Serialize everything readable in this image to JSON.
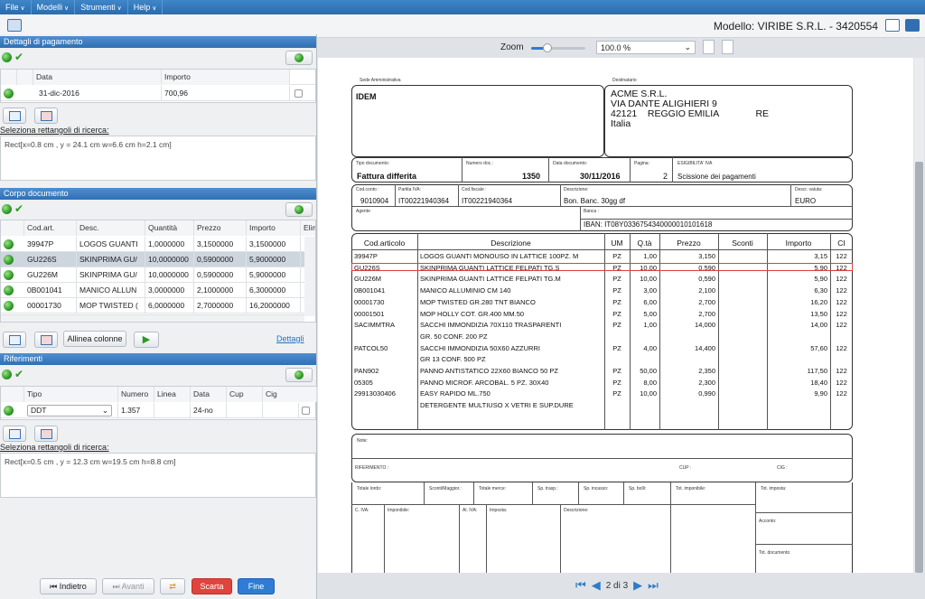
{
  "menu": [
    "File",
    "Modelli",
    "Strumenti",
    "Help"
  ],
  "model_title": "Modello: VIRIBE S.R.L. - 3420554",
  "zoom": {
    "label": "Zoom",
    "value": "100.0 %",
    "level": 0.3
  },
  "pagamento": {
    "title": "Dettagli di pagamento",
    "cols": [
      "Data",
      "Importo"
    ],
    "rows": [
      {
        "data": "31-dic-2016",
        "importo": "700,96"
      }
    ]
  },
  "ricerca1": {
    "label": "Seleziona rettangoli di ricerca:",
    "value": "Rect[x=0.8 cm , y = 24.1 cm w=6.6 cm h=2.1 cm]"
  },
  "corpo": {
    "title": "Corpo documento",
    "cols": [
      "Cod.art.",
      "Desc.",
      "Quantità",
      "Prezzo",
      "Importo",
      "Elim"
    ],
    "rows": [
      {
        "cod": "39947P",
        "desc": "LOGOS GUANTI",
        "qta": "1,0000000",
        "prezzo": "3,1500000",
        "importo": "3,1500000"
      },
      {
        "cod": "GU226S",
        "desc": "SKINPRIMA GU/",
        "qta": "10,0000000",
        "prezzo": "0,5900000",
        "importo": "5,9000000"
      },
      {
        "cod": "GU226M",
        "desc": "SKINPRIMA GU/",
        "qta": "10,0000000",
        "prezzo": "0,5900000",
        "importo": "5,9000000"
      },
      {
        "cod": "0B001041",
        "desc": "MANICO ALLUN",
        "qta": "3,0000000",
        "prezzo": "2,1000000",
        "importo": "6,3000000"
      },
      {
        "cod": "00001730",
        "desc": "MOP TWISTED (",
        "qta": "6,0000000",
        "prezzo": "2,7000000",
        "importo": "16,2000000"
      }
    ],
    "allinea": "Allinea colonne",
    "dettagli": "Dettagli"
  },
  "riferimenti": {
    "title": "Riferimenti",
    "cols": [
      "Tipo",
      "Numero",
      "Linea",
      "Data",
      "Cup",
      "Cig"
    ],
    "rows": [
      {
        "tipo": "DDT",
        "numero": "1.357",
        "linea": "",
        "data": "24-no",
        "cup": "",
        "cig": ""
      }
    ]
  },
  "ricerca2": {
    "label": "Seleziona rettangoli di ricerca:",
    "value": "Rect[x=0.5 cm , y = 12.3 cm w=19.5 cm h=8.8 cm]"
  },
  "footer": {
    "indietro": "Indietro",
    "avanti": "Avanti",
    "scarta": "Scarta",
    "fine": "Fine"
  },
  "doc": {
    "sede_label": "Sede Amministrativa",
    "sede": "IDEM",
    "dest_label": "Destinatario",
    "dest": [
      "ACME S.R.L.",
      "VIA DANTE ALIGHIERI 9",
      "42121    REGGIO EMILIA              RE",
      "Italia"
    ],
    "tipo_label": "Tipo documento:",
    "tipo": "Fattura differita",
    "num_label": "Numero doc.:",
    "num": "1350",
    "data_label": "Data documento:",
    "data": "30/11/2016",
    "pag_label": "Pagina:",
    "pag": "2",
    "esig_label": "ESIGIBILITA' IVA",
    "esig": "Scissione dei pagamenti",
    "conto_label": "Cod.conto :",
    "conto": "9010904",
    "piva_label": "Partita IVA:",
    "piva": "IT00221940364",
    "cf_label": "Cod.fiscale :",
    "cf": "IT00221940364",
    "descr_label": "Descrizione:",
    "descr": "Bon. Banc. 30gg df",
    "valuta_label": "Descr. valuta:",
    "valuta": "EURO",
    "agente_label": "Agente",
    "banca_label": "Banca :",
    "iban": "IBAN: IT08Y0336754340000010101618",
    "cols": [
      "Cod.articolo",
      "Descrizione",
      "UM",
      "Q.tà",
      "Prezzo",
      "Sconti",
      "Importo",
      "CI"
    ],
    "rows": [
      [
        "39947P",
        "LOGOS GUANTI MONOUSO IN LATTICE 100PZ. M",
        "PZ",
        "1,00",
        "3,150",
        "",
        "3,15",
        "122"
      ],
      [
        "GU226S",
        "SKINPRIMA GUANTI LATTICE FELPATI TG.S",
        "PZ",
        "10,00",
        "0,590",
        "",
        "5,90",
        "122"
      ],
      [
        "GU226M",
        "SKINPRIMA GUANTI LATTICE FELPATI TG.M",
        "PZ",
        "10,00",
        "0,590",
        "",
        "5,90",
        "122"
      ],
      [
        "0B001041",
        "MANICO ALLUMINIO CM 140",
        "PZ",
        "3,00",
        "2,100",
        "",
        "6,30",
        "122"
      ],
      [
        "00001730",
        "MOP TWISTED GR.280 TNT BIANCO",
        "PZ",
        "6,00",
        "2,700",
        "",
        "16,20",
        "122"
      ],
      [
        "00001501",
        "MOP HOLLY COT. GR.400 MM.50",
        "PZ",
        "5,00",
        "2,700",
        "",
        "13,50",
        "122"
      ],
      [
        "SACIMMTRA",
        "SACCHI IMMONDIZIA 70X110 TRASPARENTI",
        "PZ",
        "1,00",
        "14,000",
        "",
        "14,00",
        "122"
      ],
      [
        "",
        "GR. 50 CONF. 200 PZ",
        "",
        "",
        "",
        "",
        "",
        ""
      ],
      [
        "PATCOL50",
        "SACCHI IMMONDIZIA 50X60 AZZURRI",
        "PZ",
        "4,00",
        "14,400",
        "",
        "57,60",
        "122"
      ],
      [
        "",
        "GR 13 CONF. 500 PZ",
        "",
        "",
        "",
        "",
        "",
        ""
      ],
      [
        "PAN902",
        "PANNO ANTISTATICO 22X60 BIANCO 50 PZ",
        "PZ",
        "50,00",
        "2,350",
        "",
        "117,50",
        "122"
      ],
      [
        "05305",
        "PANNO MICROF. ARCOBAL. 5 PZ. 30X40",
        "PZ",
        "8,00",
        "2,300",
        "",
        "18,40",
        "122"
      ],
      [
        "29913030406",
        "EASY RAPIDO ML.750",
        "PZ",
        "10,00",
        "0,990",
        "",
        "9,90",
        "122"
      ],
      [
        "",
        "DETERGENTE MULTIUSO X VETRI E SUP.DURE",
        "",
        "",
        "",
        "",
        "",
        ""
      ]
    ],
    "note_label": "Note:",
    "rif_label": "RIFERIMENTO :",
    "cup_label": "CUP :",
    "cig_label": "CIG :",
    "tot_labels": [
      "Totale lordo:",
      "Sconti/Maggior.:",
      "Totale merce:",
      "Sp. trasp.:",
      "Sp. incasso:",
      "Sp. bolli:",
      "Tot. imponibile:",
      "Tot. imposta:"
    ],
    "iva_labels": [
      "C. IVA:",
      "Imponibile:",
      "Al. IVA:",
      "Imposta:",
      "Descrizione:"
    ],
    "acconto_label": "Acconto:",
    "totdoc_label": "Tot. documento"
  },
  "pager": "2 di 3",
  "colors": {
    "accent": "#2f6fb2",
    "scarta": "#e0443c",
    "fine": "#2e7cd6",
    "highlight": "#e04040"
  }
}
